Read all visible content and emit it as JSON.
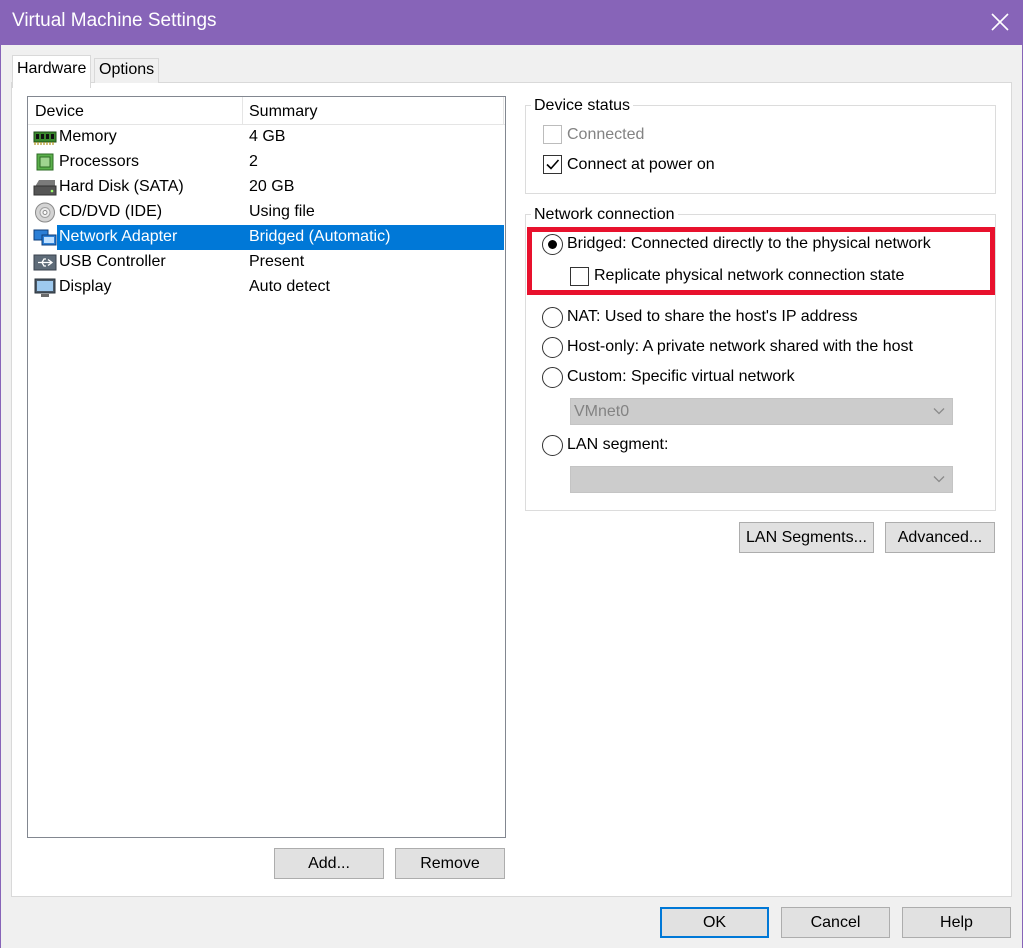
{
  "window": {
    "title": "Virtual Machine Settings",
    "close_glyph": "✕"
  },
  "tabs": [
    {
      "label": "Hardware",
      "active": true
    },
    {
      "label": "Options",
      "active": false
    }
  ],
  "device_list": {
    "columns": [
      "Device",
      "Summary"
    ],
    "rows": [
      {
        "icon": "memory-icon",
        "device": "Memory",
        "summary": "4 GB",
        "selected": false
      },
      {
        "icon": "processor-icon",
        "device": "Processors",
        "summary": "2",
        "selected": false
      },
      {
        "icon": "hard-disk-icon",
        "device": "Hard Disk (SATA)",
        "summary": "20 GB",
        "selected": false
      },
      {
        "icon": "cd-dvd-icon",
        "device": "CD/DVD (IDE)",
        "summary": "Using file",
        "selected": false
      },
      {
        "icon": "network-adapter-icon",
        "device": "Network Adapter",
        "summary": "Bridged (Automatic)",
        "selected": true
      },
      {
        "icon": "usb-icon",
        "device": "USB Controller",
        "summary": "Present",
        "selected": false
      },
      {
        "icon": "display-icon",
        "device": "Display",
        "summary": "Auto detect",
        "selected": false
      }
    ]
  },
  "list_buttons": {
    "add": "Add...",
    "remove": "Remove"
  },
  "device_status": {
    "title": "Device status",
    "connected": {
      "label": "Connected",
      "checked": false,
      "disabled": true
    },
    "connect_at_power_on": {
      "label": "Connect at power on",
      "checked": true
    }
  },
  "network_connection": {
    "title": "Network connection",
    "bridged": {
      "label": "Bridged: Connected directly to the physical network",
      "selected": true
    },
    "replicate": {
      "label": "Replicate physical network connection state",
      "checked": false
    },
    "nat": {
      "label": "NAT: Used to share the host's IP address",
      "selected": false
    },
    "host_only": {
      "label": "Host-only: A private network shared with the host",
      "selected": false
    },
    "custom": {
      "label": "Custom: Specific virtual network",
      "selected": false
    },
    "vmnet_select": {
      "value": "VMnet0"
    },
    "lan_segment": {
      "label": "LAN segment:",
      "selected": false
    },
    "lan_select": {
      "value": ""
    }
  },
  "network_buttons": {
    "lan_segments": "LAN Segments...",
    "advanced": "Advanced..."
  },
  "footer": {
    "ok": "OK",
    "cancel": "Cancel",
    "help": "Help"
  },
  "colors": {
    "titlebar": "#8764b8",
    "selection": "#0078d7",
    "highlight": "#e8112d"
  }
}
